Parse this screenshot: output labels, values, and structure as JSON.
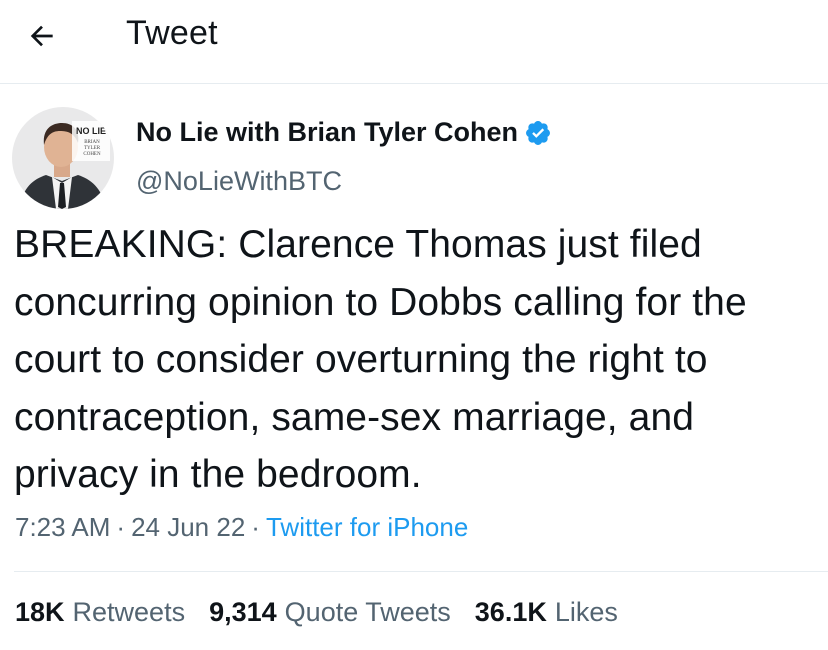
{
  "header": {
    "title": "Tweet",
    "back_icon": "arrow-left-icon"
  },
  "tweet": {
    "author": {
      "name": "No Lie with Brian Tyler Cohen",
      "handle": "@NoLieWithBTC",
      "verified": true,
      "avatar_logo_text": "NO LIE",
      "avatar_logo_subtext": "BRIAN TYLER COHEN"
    },
    "text": "BREAKING: Clarence Thomas just filed concurring opinion to Dobbs calling for the court to consider overturning the right to contraception, same-sex marriage, and privacy in the bedroom.",
    "time": "7:23 AM",
    "date": "24 Jun 22",
    "separator": "·",
    "source": "Twitter for iPhone",
    "stats": {
      "retweets_count": "18K",
      "retweets_label": "Retweets",
      "quotes_count": "9,314",
      "quotes_label": "Quote Tweets",
      "likes_count": "36.1K",
      "likes_label": "Likes"
    }
  },
  "colors": {
    "accent": "#1d9bf0",
    "text": "#0f1419",
    "secondary_text": "#536471",
    "divider": "#e6ecf0"
  }
}
